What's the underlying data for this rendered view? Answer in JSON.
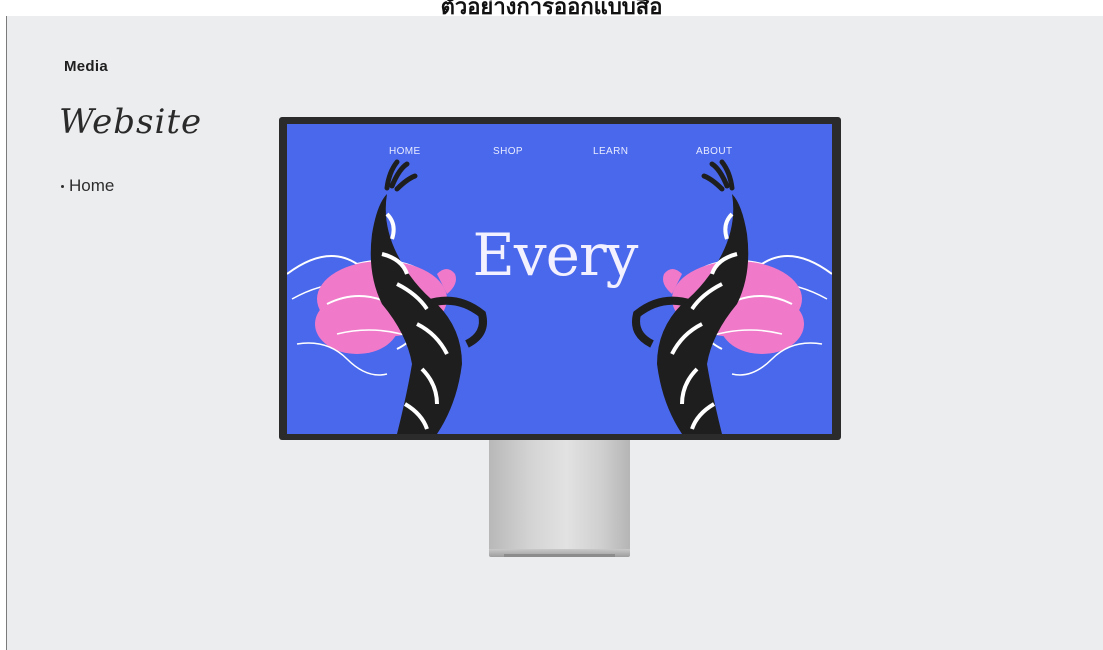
{
  "banner": {
    "text": "ตัวอย่างการออกแบบสื่อ"
  },
  "sidebar": {
    "section_label": "Media",
    "title": "Website",
    "items": [
      {
        "label": "Home"
      }
    ]
  },
  "monitor": {
    "site_nav": [
      "HOME",
      "SHOP",
      "LEARN",
      "ABOUT"
    ],
    "hero_text": "Every",
    "colors": {
      "screen_bg": "#4a68ec",
      "accent_pink": "#f07ac9",
      "stripe_black": "#1e1e1e",
      "stripe_white": "#ffffff"
    }
  }
}
